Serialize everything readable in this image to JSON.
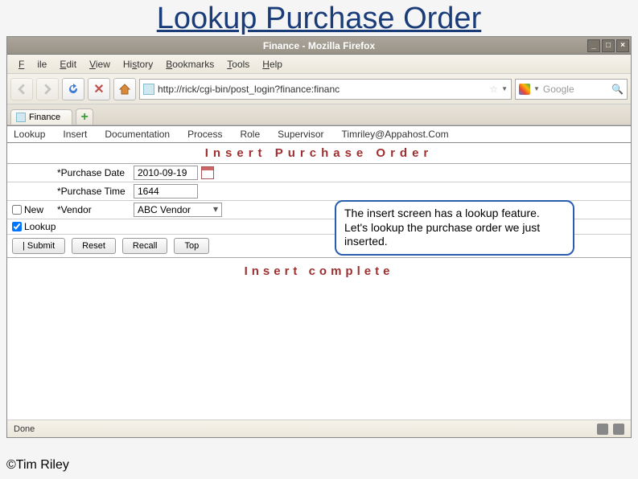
{
  "slide": {
    "title": "Lookup Purchase Order",
    "copyright": "©Tim Riley"
  },
  "browser": {
    "window_title": "Finance - Mozilla Firefox",
    "menus": {
      "file": "File",
      "edit": "Edit",
      "view": "View",
      "history": "History",
      "bookmarks": "Bookmarks",
      "tools": "Tools",
      "help": "Help"
    },
    "url": "http://rick/cgi-bin/post_login?finance:financ",
    "search_placeholder": "Google",
    "tab_label": "Finance",
    "status": "Done"
  },
  "app": {
    "menu": {
      "lookup": "Lookup",
      "insert": "Insert",
      "documentation": "Documentation",
      "process": "Process",
      "role": "Role",
      "supervisor": "Supervisor",
      "email": "Timriley@Appahost.Com"
    },
    "banner": "Insert  Purchase  Order",
    "form": {
      "purchase_date_label": "*Purchase Date",
      "purchase_date_value": "2010-09-19",
      "purchase_time_label": "*Purchase Time",
      "purchase_time_value": "1644",
      "vendor_label": "*Vendor",
      "vendor_value": "ABC Vendor",
      "new_label": "New",
      "lookup_label": "Lookup"
    },
    "buttons": {
      "submit": "|   Submit",
      "reset": "Reset",
      "recall": "Recall",
      "top": "Top"
    },
    "status_message": "Insert  complete"
  },
  "callout": {
    "text": "The insert screen has a lookup feature. Let's lookup the purchase order we just inserted."
  }
}
